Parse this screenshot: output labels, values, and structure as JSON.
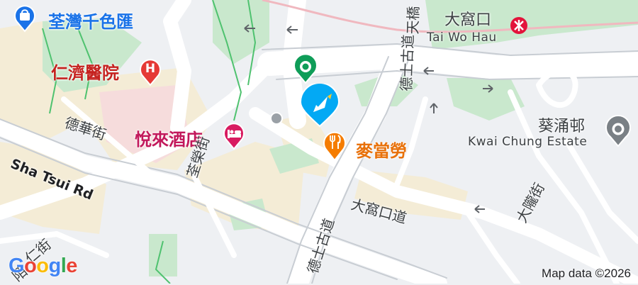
{
  "map": {
    "pois": {
      "mall": "荃灣千色匯",
      "hospital": "仁濟醫院",
      "hotel": "悅來酒店",
      "restaurant": "麥當勞"
    },
    "station": {
      "name_zh": "大窩口",
      "name_en": "Tai Wo Hau"
    },
    "estate": {
      "name_zh": "葵涌邨",
      "name_en": "Kwai Chung Estate"
    },
    "streets": {
      "sha_tsui": "Sha Tsui Rd",
      "tak_wah": "德華街",
      "chuen_wing": "荃榮街",
      "tai_wo_hau": "大窩口道",
      "tak_sze_kwu_lower": "德士古道",
      "tak_sze_kwu_upper": "德士古道",
      "tin_fuk": "天橋",
      "tai_loong": "大隴街",
      "yan_yan": "仁街",
      "yan_prefix": "陌"
    },
    "attribution": "Map data ©2026",
    "logo_letters": [
      "G",
      "o",
      "o",
      "g",
      "l",
      "e"
    ],
    "logo_colors": [
      "#4285F4",
      "#EA4335",
      "#FBBC05",
      "#4285F4",
      "#34A853",
      "#EA4335"
    ],
    "colors": {
      "hospital": "#e53935",
      "hotel": "#d81b60",
      "restaurant": "#f57c00",
      "mall": "#1a73e8",
      "park": "#c9e8cd",
      "metro": "#e3133b",
      "marker": "#03a9f4",
      "pin": "#0f9d58"
    },
    "icons": [
      "shopping-bag-icon",
      "hospital-icon",
      "bed-icon",
      "fork-knife-icon",
      "mtr-icon",
      "place-pin-icon",
      "navigation-marker-icon",
      "estate-pin-icon"
    ]
  }
}
